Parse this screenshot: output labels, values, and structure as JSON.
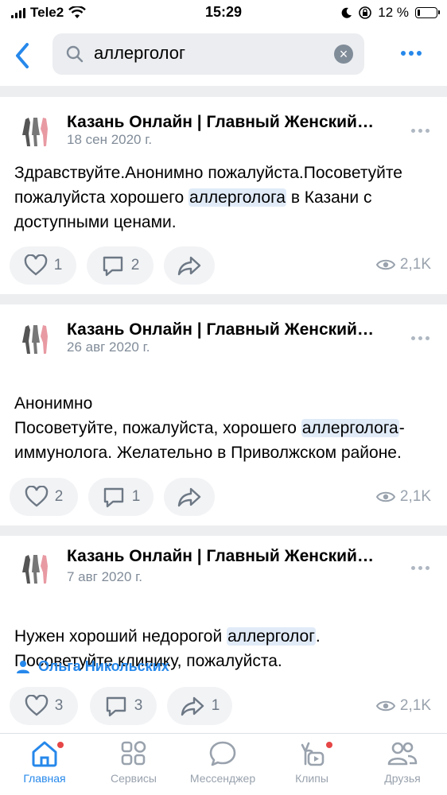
{
  "status_bar": {
    "carrier": "Tele2",
    "time": "15:29",
    "battery": "12 %"
  },
  "search": {
    "query": "аллерголог"
  },
  "posts": [
    {
      "title": "Казань Онлайн | Главный Женский…",
      "date": "18 сен 2020 г.",
      "text_before": "Здравствуйте.Анонимно пожалуйста.Посоветуйте пожалуйста хорошего ",
      "highlight": "аллерголога",
      "text_after": " в Казани с доступными ценами.",
      "likes": "1",
      "comments": "2",
      "shares": "",
      "views": "2,1K"
    },
    {
      "title": "Казань Онлайн | Главный Женский…",
      "date": "26 авг 2020 г.",
      "text_before": "Анонимно\nПосоветуйте, пожалуйста, хорошего ",
      "highlight": "аллерголога",
      "text_after": "-иммунолога. Желательно в Приволжском районе.",
      "likes": "2",
      "comments": "1",
      "shares": "",
      "views": "2,1K"
    },
    {
      "title": "Казань Онлайн | Главный Женский…",
      "date": "7 авг 2020 г.",
      "text_before": "Нужен хороший недорогой ",
      "highlight": "аллерголог",
      "text_after": ".\nПосоветуйте клинику, пожалуйста.",
      "author": "Ольга Никольских",
      "likes": "3",
      "comments": "3",
      "shares": "1",
      "views": "2,1K"
    }
  ],
  "tabs": [
    {
      "label": "Главная",
      "icon": "home-icon",
      "active": true
    },
    {
      "label": "Сервисы",
      "icon": "services-icon"
    },
    {
      "label": "Мессенджер",
      "icon": "messenger-icon"
    },
    {
      "label": "Клипы",
      "icon": "clips-icon"
    },
    {
      "label": "Друзья",
      "icon": "friends-icon"
    }
  ],
  "colors": {
    "accent": "#2688eb",
    "highlight": "#e1ebf8",
    "badge": "#e64646",
    "muted": "#818c99"
  }
}
